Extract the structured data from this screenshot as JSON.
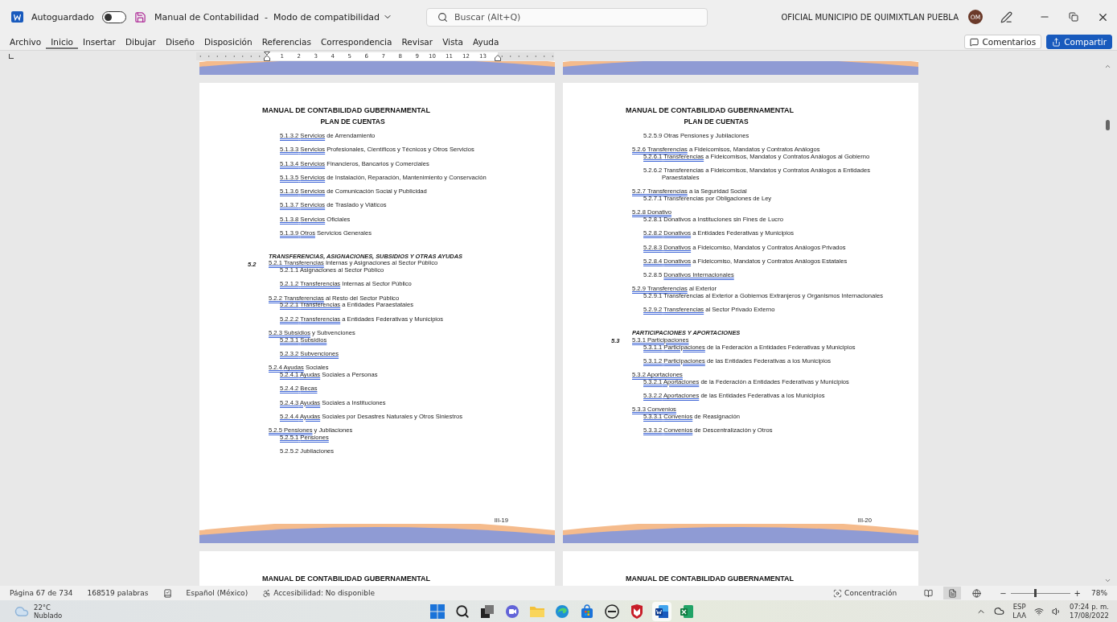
{
  "title_bar": {
    "autosave_label": "Autoguardado",
    "autosave_on": false,
    "document_title": "Manual de Contabilidad  -  Modo de compatibilidad",
    "search": {
      "placeholder": "Buscar (Alt+Q)"
    },
    "user_name": "OFICIAL MUNICIPIO DE QUIMIXTLAN PUEBLA",
    "avatar_initials": "OM"
  },
  "ribbon_tabs": [
    {
      "label": "Archivo",
      "selected": false
    },
    {
      "label": "Inicio",
      "selected": true
    },
    {
      "label": "Insertar",
      "selected": false
    },
    {
      "label": "Dibujar",
      "selected": false
    },
    {
      "label": "Diseño",
      "selected": false
    },
    {
      "label": "Disposición",
      "selected": false
    },
    {
      "label": "Referencias",
      "selected": false
    },
    {
      "label": "Correspondencia",
      "selected": false
    },
    {
      "label": "Revisar",
      "selected": false
    },
    {
      "label": "Vista",
      "selected": false
    },
    {
      "label": "Ayuda",
      "selected": false
    }
  ],
  "ribbon_buttons": [
    {
      "label": "Comentarios",
      "kind": "comments"
    },
    {
      "label": "Compartir",
      "kind": "share"
    }
  ],
  "ruler": {
    "numbers": [
      "1",
      "2",
      "3",
      "4",
      "5",
      "6",
      "7",
      "8",
      "9",
      "10",
      "11",
      "12",
      "13"
    ]
  },
  "pages": [
    {
      "header_title": "MANUAL DE CONTABILIDAD GUBERNAMENTAL",
      "header_subtitle": "PLAN DE CUENTAS",
      "page_number": "III-19",
      "blocks": [
        {
          "kind": "sub_items",
          "children": [
            {
              "code": "5.1.3.2",
              "term": "Servicios",
              "text": "de Arrendamiento",
              "code_flagged": true,
              "term_flagged": true
            },
            {
              "code": "5.1.3.3",
              "term": "Servicios",
              "text": "Profesionales, Científicos y Técnicos y Otros Servicios",
              "code_flagged": true,
              "term_flagged": true
            },
            {
              "code": "5.1.3.4",
              "term": "Servicios",
              "text": "Financieros, Bancarios y Comerciales",
              "code_flagged": true,
              "term_flagged": true
            },
            {
              "code": "5.1.3.5",
              "term": "Servicios",
              "text": "de Instalación, Reparación, Mantenimiento y Conservación",
              "code_flagged": true,
              "term_flagged": true
            },
            {
              "code": "5.1.3.6",
              "term": "Servicios",
              "text": "de Comunicación Social y Publicidad",
              "code_flagged": true,
              "term_flagged": true
            },
            {
              "code": "5.1.3.7",
              "term": "Servicios",
              "text": "de Traslado y Viáticos",
              "code_flagged": true,
              "term_flagged": true
            },
            {
              "code": "5.1.3.8",
              "term": "Servicios",
              "text": "Oficiales",
              "code_flagged": true,
              "term_flagged": true
            },
            {
              "code": "5.1.3.9",
              "term": "Otros",
              "text": "Servicios Generales",
              "code_flagged": true,
              "term_flagged": true
            }
          ]
        },
        {
          "kind": "section",
          "number": "5.2",
          "title": "TRANSFERENCIAS, ASIGNACIONES, SUBSIDIOS Y OTRAS AYUDAS",
          "children": [
            {
              "code": "5.2.1",
              "term": "Transferencias",
              "text": "Internas y Asignaciones al Sector Público",
              "code_flagged": true,
              "term_flagged": true,
              "children": [
                {
                  "code": "5.2.1.1",
                  "text": "Asignaciones al Sector Público",
                  "code_flagged": false
                },
                {
                  "code": "5.2.1.2",
                  "term": "Transferencias",
                  "text": "Internas al Sector Público",
                  "code_flagged": true,
                  "term_flagged": true
                }
              ]
            },
            {
              "code": "5.2.2",
              "term": "Transferencias",
              "text": "al Resto del Sector Público",
              "code_flagged": true,
              "term_flagged": true,
              "children": [
                {
                  "code": "5.2.2.1",
                  "term": "Transferencias",
                  "text": "a Entidades Paraestatales",
                  "code_flagged": true,
                  "term_flagged": true
                },
                {
                  "code": "5.2.2.2",
                  "term": "Transferencias",
                  "text": "a Entidades Federativas y Municipios",
                  "code_flagged": true,
                  "term_flagged": true
                }
              ]
            },
            {
              "code": "5.2.3",
              "term": "Subsidios",
              "text": "y Subvenciones",
              "code_flagged": true,
              "term_flagged": true,
              "children": [
                {
                  "code": "5.2.3.1",
                  "term": "Subsidios",
                  "code_flagged": true,
                  "term_flagged": true
                },
                {
                  "code": "5.2.3.2",
                  "term": "Subvenciones",
                  "code_flagged": true,
                  "term_flagged": true
                }
              ]
            },
            {
              "code": "5.2.4",
              "term": "Ayudas",
              "text": "Sociales",
              "code_flagged": true,
              "term_flagged": true,
              "children": [
                {
                  "code": "5.2.4.1",
                  "term": "Ayudas",
                  "text": "Sociales a Personas",
                  "code_flagged": true,
                  "term_flagged": true
                },
                {
                  "code": "5.2.4.2",
                  "term": "Becas",
                  "code_flagged": true,
                  "term_flagged": true
                },
                {
                  "code": "5.2.4.3",
                  "term": "Ayudas",
                  "text": "Sociales a Instituciones",
                  "code_flagged": true,
                  "term_flagged": true
                },
                {
                  "code": "5.2.4.4",
                  "term": "Ayudas",
                  "text": "Sociales por Desastres Naturales y Otros Siniestros",
                  "code_flagged": true,
                  "term_flagged": true
                }
              ]
            },
            {
              "code": "5.2.5",
              "term": "Pensiones",
              "text": "y Jubilaciones",
              "code_flagged": true,
              "term_flagged": true,
              "children": [
                {
                  "code": "5.2.5.1",
                  "term": "Pensiones",
                  "code_flagged": true,
                  "term_flagged": true
                },
                {
                  "code": "5.2.5.2",
                  "text": "Jubilaciones",
                  "code_flagged": false
                }
              ]
            }
          ]
        }
      ]
    },
    {
      "header_title": "MANUAL DE CONTABILIDAD GUBERNAMENTAL",
      "header_subtitle": "PLAN DE CUENTAS",
      "page_number": "III-20",
      "blocks": [
        {
          "kind": "sub_items",
          "children": [
            {
              "code": "5.2.5.9",
              "text": "Otras Pensiones y Jubilaciones",
              "code_flagged": false
            }
          ]
        },
        {
          "kind": "items",
          "children": [
            {
              "code": "5.2.6",
              "term": "Transferencias",
              "text": "a Fideicomisos, Mandatos y Contratos Análogos",
              "code_flagged": true,
              "term_flagged": true,
              "children": [
                {
                  "code": "5.2.6.1",
                  "term": "Transferencias",
                  "text": "a Fideicomisos, Mandatos y Contratos Análogos al Gobierno",
                  "code_flagged": true,
                  "term_flagged": true
                },
                {
                  "code": "5.2.6.2",
                  "text": "Transferencias a Fideicomisos, Mandatos y Contratos Análogos a Entidades Paraestatales",
                  "code_flagged": false
                }
              ]
            },
            {
              "code": "5.2.7",
              "term": "Transferencias",
              "text": "a la Seguridad Social",
              "code_flagged": true,
              "term_flagged": true,
              "children": [
                {
                  "code": "5.2.7.1",
                  "text": "Transferencias por Obligaciones de Ley",
                  "code_flagged": false
                }
              ]
            },
            {
              "code": "5.2.8",
              "term": "Donativo",
              "code_flagged": true,
              "term_flagged": true,
              "children": [
                {
                  "code": "5.2.8.1",
                  "text": "Donativos a Instituciones sin Fines de Lucro",
                  "code_flagged": false
                },
                {
                  "code": "5.2.8.2",
                  "term": "Donativos",
                  "text": "a Entidades Federativas y Municipios",
                  "code_flagged": true,
                  "term_flagged": true
                },
                {
                  "code": "5.2.8.3",
                  "term": "Donativos",
                  "text": "a Fideicomiso, Mandatos y Contratos Análogos Privados",
                  "code_flagged": true,
                  "term_flagged": true
                },
                {
                  "code": "5.2.8.4",
                  "term": "Donativos",
                  "text": "a Fideicomiso, Mandatos y Contratos Análogos Estatales",
                  "code_flagged": true,
                  "term_flagged": true
                },
                {
                  "code": "5.2.8.5",
                  "term": "Donativos  Internacionales",
                  "code_flagged": false,
                  "term_flagged": true
                }
              ]
            },
            {
              "code": "5.2.9",
              "term": "Transferencias",
              "text": "al Exterior",
              "code_flagged": true,
              "term_flagged": true,
              "children": [
                {
                  "code": "5.2.9.1",
                  "text": "Transferencias al Exterior a Gobiernos Extranjeros y Organismos Internacionales",
                  "code_flagged": false
                },
                {
                  "code": "5.2.9.2",
                  "term": "Transferencias",
                  "text": "al Sector Privado Externo",
                  "code_flagged": true,
                  "term_flagged": true
                }
              ]
            }
          ]
        },
        {
          "kind": "section",
          "number": "5.3",
          "title": "PARTICIPACIONES Y APORTACIONES",
          "children": [
            {
              "code": "5.3.1",
              "term": "Participaciones",
              "code_flagged": true,
              "term_flagged": true,
              "children": [
                {
                  "code": "5.3.1.1",
                  "term": "Participaciones",
                  "text": "de la Federación a Entidades Federativas y Municipios",
                  "code_flagged": true,
                  "term_flagged": true
                },
                {
                  "code": "5.3.1.2",
                  "term": "Participaciones",
                  "text": "de las Entidades Federativas a los Municipios",
                  "code_flagged": true,
                  "term_flagged": true
                }
              ]
            },
            {
              "code": "5.3.2",
              "term": "Aportaciones",
              "code_flagged": true,
              "term_flagged": true,
              "children": [
                {
                  "code": "5.3.2.1",
                  "term": "Aportaciones",
                  "text": "de la Federación a Entidades Federativas y Municipios",
                  "code_flagged": true,
                  "term_flagged": true
                },
                {
                  "code": "5.3.2.2",
                  "term": "Aportaciones",
                  "text": "de las Entidades Federativas a los Municipios",
                  "code_flagged": true,
                  "term_flagged": true
                }
              ]
            },
            {
              "code": "5.3.3",
              "term": "Convenios",
              "code_flagged": true,
              "term_flagged": true,
              "children": [
                {
                  "code": "5.3.3.1",
                  "term": "Convenios",
                  "text": "de Reasignación",
                  "code_flagged": true,
                  "term_flagged": true
                },
                {
                  "code": "5.3.3.2",
                  "term": "Convenios",
                  "text": "de Descentralización y Otros",
                  "code_flagged": true,
                  "term_flagged": true
                }
              ]
            }
          ]
        }
      ]
    }
  ],
  "next_pages": [
    {
      "header_title": "MANUAL DE CONTABILIDAD GUBERNAMENTAL"
    },
    {
      "header_title": "MANUAL DE CONTABILIDAD GUBERNAMENTAL"
    }
  ],
  "status_bar": {
    "page": "Página 67 de 734",
    "words": "168519 palabras",
    "language": "Español (México)",
    "accessibility": "Accesibilidad: No disponible",
    "focus": "Concentración",
    "views": [
      {
        "kind": "read",
        "selected": false
      },
      {
        "kind": "print",
        "selected": true
      },
      {
        "kind": "web",
        "selected": false
      }
    ],
    "zoom": {
      "minus": "−",
      "plus": "+",
      "level": 0.42,
      "reading": "78%"
    }
  },
  "taskbar": {
    "weather": {
      "temperature": "22°C",
      "condition": "Nublado"
    },
    "apps": [
      {
        "kind": "start",
        "selected": false
      },
      {
        "kind": "search",
        "selected": false
      },
      {
        "kind": "taskview",
        "selected": false
      },
      {
        "kind": "chat",
        "selected": false
      },
      {
        "kind": "folder",
        "selected": false
      },
      {
        "kind": "edge",
        "selected": false
      },
      {
        "kind": "store",
        "selected": false
      },
      {
        "kind": "dell",
        "selected": false
      },
      {
        "kind": "shield",
        "selected": false
      },
      {
        "kind": "word",
        "selected": true
      },
      {
        "kind": "excel",
        "selected": false
      }
    ],
    "input_language": [
      "ESP",
      "LAA"
    ],
    "time": "07:24 p. m.",
    "date": "17/08/2022"
  }
}
